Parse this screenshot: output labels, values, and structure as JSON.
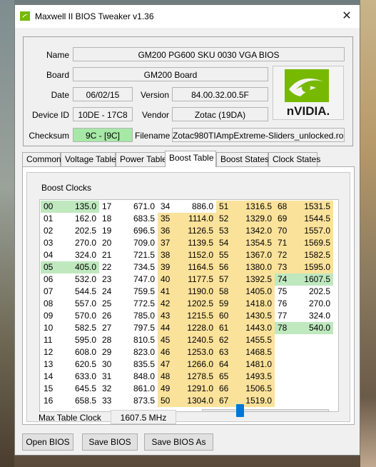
{
  "window": {
    "title": "Maxwell II BIOS Tweaker v1.36",
    "close_glyph": "✕"
  },
  "info": {
    "name_label": "Name",
    "name_value": "GM200 PG600 SKU 0030 VGA BIOS",
    "board_label": "Board",
    "board_value": "GM200 Board",
    "date_label": "Date",
    "date_value": "06/02/15",
    "version_label": "Version",
    "version_value": "84.00.32.00.5F",
    "device_label": "Device ID",
    "device_value": "10DE - 17C8",
    "vendor_label": "Vendor",
    "vendor_value": "Zotac (19DA)",
    "checksum_label": "Checksum",
    "checksum_value": "9C - [9C]",
    "filename_label": "Filename",
    "filename_value": "Zotac980TIAmpExtreme-Sliders_unlocked.rom",
    "logo_text": "nVIDIA.",
    "checksum_color": "#a6e8a6"
  },
  "tabs": [
    "Common",
    "Voltage Table",
    "Power Table",
    "Boost Table",
    "Boost States",
    "Clock States"
  ],
  "active_tab": "Boost Table",
  "boost": {
    "group_title": "Boost Clocks",
    "columns": [
      [
        [
          "00",
          "135.0",
          "green"
        ],
        [
          "01",
          "162.0",
          ""
        ],
        [
          "02",
          "202.5",
          ""
        ],
        [
          "03",
          "270.0",
          ""
        ],
        [
          "04",
          "324.0",
          ""
        ],
        [
          "05",
          "405.0",
          "green"
        ],
        [
          "06",
          "532.0",
          ""
        ],
        [
          "07",
          "544.5",
          ""
        ],
        [
          "08",
          "557.0",
          ""
        ],
        [
          "09",
          "570.0",
          ""
        ],
        [
          "10",
          "582.5",
          ""
        ],
        [
          "11",
          "595.0",
          ""
        ],
        [
          "12",
          "608.0",
          ""
        ],
        [
          "13",
          "620.5",
          ""
        ],
        [
          "14",
          "633.0",
          ""
        ],
        [
          "15",
          "645.5",
          ""
        ],
        [
          "16",
          "658.5",
          ""
        ]
      ],
      [
        [
          "17",
          "671.0",
          ""
        ],
        [
          "18",
          "683.5",
          ""
        ],
        [
          "19",
          "696.5",
          ""
        ],
        [
          "20",
          "709.0",
          ""
        ],
        [
          "21",
          "721.5",
          ""
        ],
        [
          "22",
          "734.5",
          ""
        ],
        [
          "23",
          "747.0",
          ""
        ],
        [
          "24",
          "759.5",
          ""
        ],
        [
          "25",
          "772.5",
          ""
        ],
        [
          "26",
          "785.0",
          ""
        ],
        [
          "27",
          "797.5",
          ""
        ],
        [
          "28",
          "810.5",
          ""
        ],
        [
          "29",
          "823.0",
          ""
        ],
        [
          "30",
          "835.5",
          ""
        ],
        [
          "31",
          "848.0",
          ""
        ],
        [
          "32",
          "861.0",
          ""
        ],
        [
          "33",
          "873.5",
          ""
        ]
      ],
      [
        [
          "34",
          "886.0",
          ""
        ],
        [
          "35",
          "1114.0",
          "yellow"
        ],
        [
          "36",
          "1126.5",
          "yellow"
        ],
        [
          "37",
          "1139.5",
          "yellow"
        ],
        [
          "38",
          "1152.0",
          "yellow"
        ],
        [
          "39",
          "1164.5",
          "yellow"
        ],
        [
          "40",
          "1177.5",
          "yellow"
        ],
        [
          "41",
          "1190.0",
          "yellow"
        ],
        [
          "42",
          "1202.5",
          "yellow"
        ],
        [
          "43",
          "1215.5",
          "yellow"
        ],
        [
          "44",
          "1228.0",
          "yellow"
        ],
        [
          "45",
          "1240.5",
          "yellow"
        ],
        [
          "46",
          "1253.0",
          "yellow"
        ],
        [
          "47",
          "1266.0",
          "yellow"
        ],
        [
          "48",
          "1278.5",
          "yellow"
        ],
        [
          "49",
          "1291.0",
          "yellow"
        ],
        [
          "50",
          "1304.0",
          "yellow"
        ]
      ],
      [
        [
          "51",
          "1316.5",
          "yellow"
        ],
        [
          "52",
          "1329.0",
          "yellow"
        ],
        [
          "53",
          "1342.0",
          "yellow"
        ],
        [
          "54",
          "1354.5",
          "yellow"
        ],
        [
          "55",
          "1367.0",
          "yellow"
        ],
        [
          "56",
          "1380.0",
          "yellow"
        ],
        [
          "57",
          "1392.5",
          "yellow"
        ],
        [
          "58",
          "1405.0",
          "yellow"
        ],
        [
          "59",
          "1418.0",
          "yellow"
        ],
        [
          "60",
          "1430.5",
          "yellow"
        ],
        [
          "61",
          "1443.0",
          "yellow"
        ],
        [
          "62",
          "1455.5",
          "yellow"
        ],
        [
          "63",
          "1468.5",
          "yellow"
        ],
        [
          "64",
          "1481.0",
          "yellow"
        ],
        [
          "65",
          "1493.5",
          "yellow"
        ],
        [
          "66",
          "1506.5",
          "yellow"
        ],
        [
          "67",
          "1519.0",
          "yellow"
        ]
      ],
      [
        [
          "68",
          "1531.5",
          "yellow"
        ],
        [
          "69",
          "1544.5",
          "yellow"
        ],
        [
          "70",
          "1557.0",
          "yellow"
        ],
        [
          "71",
          "1569.5",
          "yellow"
        ],
        [
          "72",
          "1582.5",
          "yellow"
        ],
        [
          "73",
          "1595.0",
          "yellow"
        ],
        [
          "74",
          "1607.5",
          "green"
        ],
        [
          "75",
          "202.5",
          ""
        ],
        [
          "76",
          "270.0",
          ""
        ],
        [
          "77",
          "324.0",
          ""
        ],
        [
          "78",
          "540.0",
          "green"
        ]
      ]
    ],
    "max_clock_label": "Max Table Clock",
    "max_clock_value": "1607.5 MHz",
    "slider_fraction": 0.3
  },
  "buttons": {
    "open": "Open BIOS",
    "save": "Save BIOS",
    "save_as": "Save BIOS As"
  },
  "colors": {
    "yellow": "#fbe29b",
    "green": "#bfe8bf",
    "accent": "#0078d7",
    "nvidia_green": "#76b900"
  }
}
